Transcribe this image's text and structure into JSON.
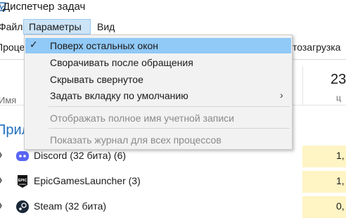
{
  "window": {
    "title": "Диспетчер задач"
  },
  "menubar": {
    "file": "Файл",
    "options": "Параметры",
    "view": "Вид"
  },
  "tabs": {
    "processes": "Проце",
    "startup": "тозагрузка"
  },
  "columns": {
    "name": "Имя",
    "cpu_value": "23",
    "cpu_label": "ц"
  },
  "group": {
    "apps": "Прил"
  },
  "rows": [
    {
      "name": "Discord (32 бита) (6)",
      "cpu": "1,",
      "icon": "discord-icon",
      "color": "#5865F2"
    },
    {
      "name": "EpicGamesLauncher (3)",
      "cpu": "1,",
      "icon": "epic-games-icon",
      "color": "#111111"
    },
    {
      "name": "Steam (32 бита)",
      "cpu": "0,",
      "icon": "steam-icon",
      "color": "#1b2838"
    }
  ],
  "options_menu": {
    "always_on_top": "Поверх остальных окон",
    "minimize_on_use": "Сворачивать после обращения",
    "hide_when_minimized": "Скрывать свернутое",
    "set_default_tab": "Задать вкладку по умолчанию",
    "show_full_account_name": "Отображать полное имя учетной записи",
    "show_history_all": "Показать журнал для всех процессов",
    "check_mark": "✓",
    "submenu_arrow": "›"
  },
  "colors": {
    "highlight": "#91c9f7",
    "menu_selected": "#cce4f7",
    "cpu_cell": "#fff4c4",
    "group_header": "#1f6fbf"
  }
}
